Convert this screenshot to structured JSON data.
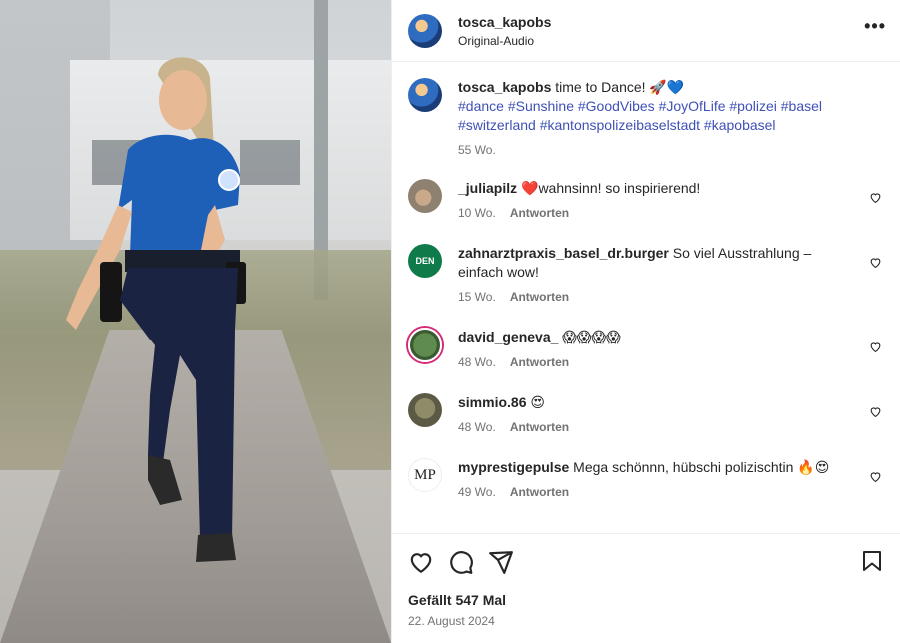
{
  "post": {
    "username": "tosca_kapobs",
    "audio": "Original-Audio",
    "more": "•••"
  },
  "caption": {
    "username": "tosca_kapobs",
    "text": "time to Dance! 🚀💙",
    "hashtags_line1": "#dance #Sunshine #GoodVibes #JoyOfLife #polizei #basel",
    "hashtags_line2": "#switzerland #kantonspolizeibaselstadt #kapobasel",
    "age": "55 Wo."
  },
  "comments": [
    {
      "username": "_juliapilz",
      "text": "❤️wahnsinn! so inspirierend!",
      "age": "10 Wo.",
      "reply": "Antworten"
    },
    {
      "username": "zahnarztpraxis_basel_dr.burger",
      "text": "So viel Ausstrahlung – einfach wow!",
      "age": "15 Wo.",
      "reply": "Antworten",
      "avatar_text": "DEN"
    },
    {
      "username": "david_geneva_",
      "text": "😱😱😱😱",
      "age": "48 Wo.",
      "reply": "Antworten"
    },
    {
      "username": "simmio.86",
      "text": "😍",
      "age": "48 Wo.",
      "reply": "Antworten"
    },
    {
      "username": "myprestigepulse",
      "text": "Mega schönnn, hübschi polizischtin 🔥😍",
      "age": "49 Wo.",
      "reply": "Antworten",
      "avatar_text": "MP"
    }
  ],
  "footer": {
    "likes": "Gefällt 547 Mal",
    "date": "22. August 2024"
  },
  "icons": {
    "more": "more-icon",
    "like": "heart-icon",
    "comment": "comment-icon",
    "share": "share-icon",
    "save": "bookmark-icon"
  }
}
